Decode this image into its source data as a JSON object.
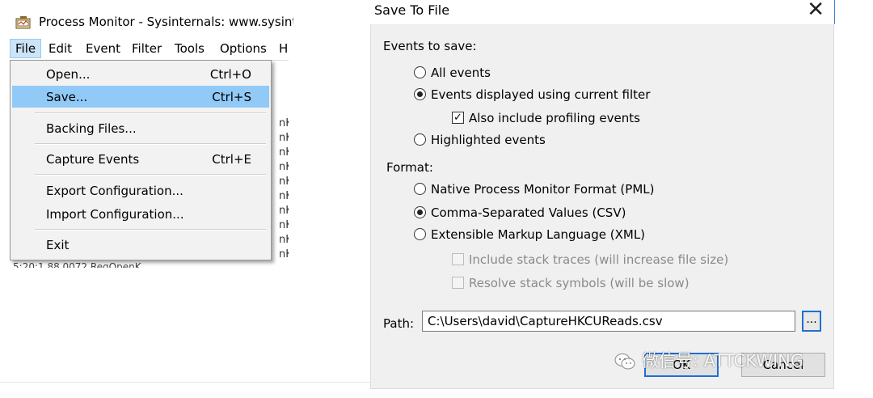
{
  "procmon": {
    "title": "Process Monitor - Sysinternals: www.sysinte",
    "menus": [
      "File",
      "Edit",
      "Event",
      "Filter",
      "Tools",
      "Options",
      "H"
    ],
    "file_menu": {
      "open": {
        "label": "Open...",
        "shortcut": "Ctrl+O"
      },
      "save": {
        "label": "Save...",
        "shortcut": "Ctrl+S"
      },
      "backing_files": {
        "label": "Backing Files..."
      },
      "capture_events": {
        "label": "Capture Events",
        "shortcut": "Ctrl+E"
      },
      "export_config": {
        "label": "Export Configuration..."
      },
      "import_config": {
        "label": "Import Configuration..."
      },
      "exit": {
        "label": "Exit"
      }
    },
    "list_fragments": [
      "nK",
      "nK",
      "nK",
      "nK",
      "nK",
      "nK",
      "nK",
      "nK",
      "nK",
      "nK"
    ],
    "row_fragment": "5:20:1      88      0072  RegOpenK"
  },
  "dialog": {
    "title": "Save To File",
    "close_glyph": "✕",
    "events_label": "Events to save:",
    "events_options": {
      "all": "All events",
      "filtered": "Events displayed using current filter",
      "profiling": "Also include profiling events",
      "highlighted": "Highlighted events"
    },
    "events_selected": "Events displayed using current filter",
    "profiling_checked": true,
    "format_label": "Format:",
    "format_options": {
      "pml": "Native Process Monitor Format (PML)",
      "csv": "Comma-Separated Values (CSV)",
      "xml": "Extensible Markup Language (XML)"
    },
    "format_selected": "Comma-Separated Values (CSV)",
    "xml_options": {
      "stack_traces": "Include stack traces (will increase file size)",
      "stack_symbols": "Resolve stack symbols (will be slow)"
    },
    "path_label": "Path:",
    "path_value": "C:\\Users\\david\\CaptureHKCUReads.csv",
    "browse_label": "...",
    "ok_label": "OK",
    "cancel_label": "Cancel"
  },
  "watermark": {
    "text": "微信号: ATTCKWING",
    "icon": "wechat-icon"
  },
  "colors": {
    "menu_highlight": "#91c9f7",
    "dialog_bg": "#f0f0f0",
    "focus_border": "#1f6fd1"
  }
}
